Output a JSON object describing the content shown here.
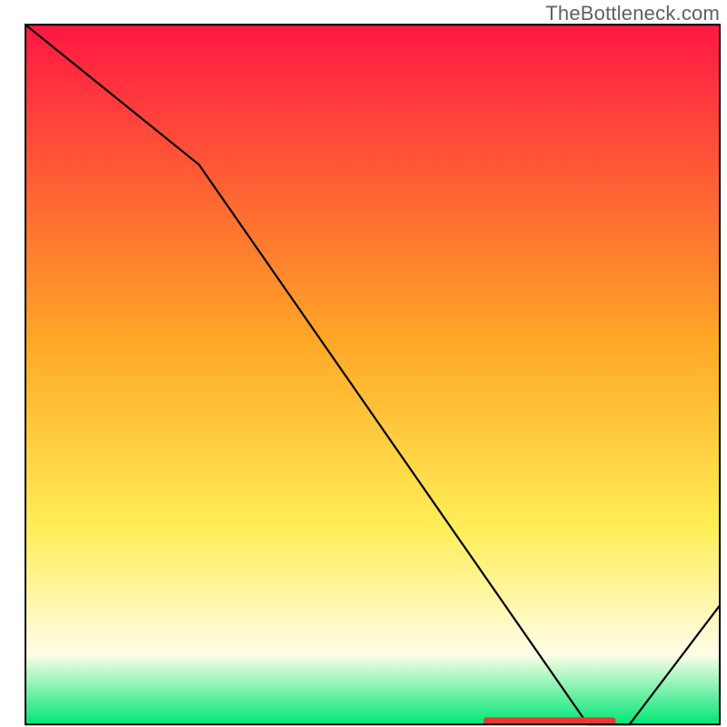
{
  "watermark": "TheBottleneck.com",
  "colors": {
    "red": "#ff1744",
    "orange": "#ffa726",
    "yellow": "#ffee58",
    "pale_yellow": "#fffde7",
    "green": "#00e676",
    "line": "#000000",
    "marker": "#e53935",
    "frame": "#000000"
  },
  "chart_data": {
    "type": "line",
    "title": "",
    "xlabel": "",
    "ylabel": "",
    "xlim": [
      0,
      100
    ],
    "ylim": [
      0,
      100
    ],
    "x": [
      0,
      25,
      81,
      87,
      100
    ],
    "values": [
      100,
      80,
      0,
      0,
      17
    ],
    "marker_region": {
      "x_start": 66,
      "x_end": 85,
      "y": 0.5
    },
    "frame": {
      "x": 3.5,
      "y": 3.4,
      "w": 95.5,
      "h": 96.25
    }
  }
}
